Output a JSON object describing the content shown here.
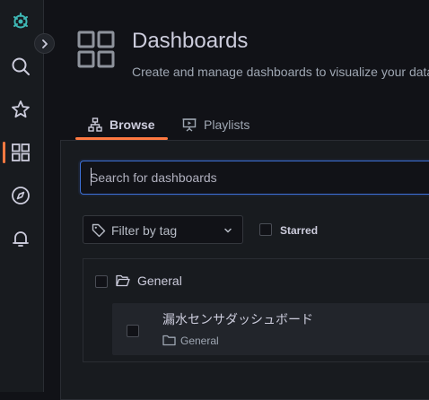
{
  "sidebar": {
    "icons": [
      "grafana-logo-icon",
      "search-icon",
      "star-icon",
      "dashboards-grid-icon",
      "compass-icon",
      "bell-icon"
    ],
    "active_item": "dashboards-grid-icon",
    "accent_color": "#ff7941"
  },
  "header": {
    "title": "Dashboards",
    "subtitle": "Create and manage dashboards to visualize your data"
  },
  "tabs": [
    {
      "label": "Browse",
      "active": true
    },
    {
      "label": "Playlists",
      "active": false
    }
  ],
  "search": {
    "placeholder": "Search for dashboards",
    "value": ""
  },
  "filter": {
    "tag_placeholder": "Filter by tag",
    "starred_label": "Starred"
  },
  "folders": [
    {
      "name": "General",
      "dashboards": [
        {
          "title": "漏水センサダッシュボード",
          "folder": "General"
        }
      ]
    }
  ]
}
